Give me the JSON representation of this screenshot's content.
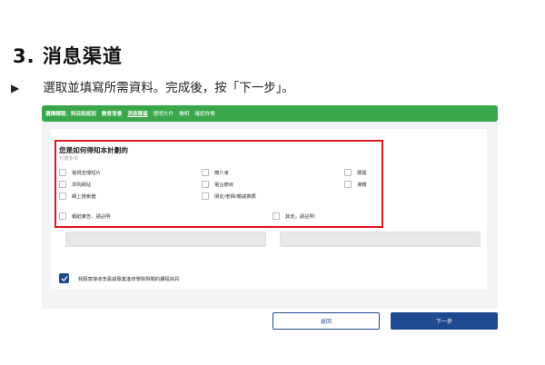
{
  "heading": "3. 消息渠道",
  "instruction": {
    "arrow": "▶",
    "text": "選取並填寫所需資料。完成後，按「下一步」。"
  },
  "steps": [
    {
      "label": "選擇課程、科目和班別",
      "state": "done"
    },
    {
      "label": "教育背景",
      "state": "done"
    },
    {
      "label": "消息渠道",
      "state": "current"
    },
    {
      "label": "證明文件",
      "state": "pending"
    },
    {
      "label": "聲明",
      "state": "pending"
    },
    {
      "label": "確認詳情",
      "state": "pending"
    }
  ],
  "question": {
    "title": "您是如何得知本計劃的",
    "hint": "可選多項"
  },
  "options": [
    {
      "label": "電視宣傳短片"
    },
    {
      "label": "簡介會"
    },
    {
      "label": "展覽"
    },
    {
      "label": "本院網站"
    },
    {
      "label": "電台節目"
    },
    {
      "label": "港鐵"
    },
    {
      "label": "網上搜索器"
    },
    {
      "label": "朋友/老師/親戚推薦"
    },
    {
      "label": "報紙廣告，請註明"
    },
    {
      "label": "其他，請註明："
    }
  ],
  "consent": {
    "checked": true,
    "label": "我願意接收李嘉誠專業進修學院相關的課程資訊"
  },
  "buttons": {
    "back": "返回",
    "next": "下一步"
  },
  "colors": {
    "accent_green": "#3aa84a",
    "primary_blue": "#1e4a91",
    "highlight_red": "#e0191f"
  }
}
